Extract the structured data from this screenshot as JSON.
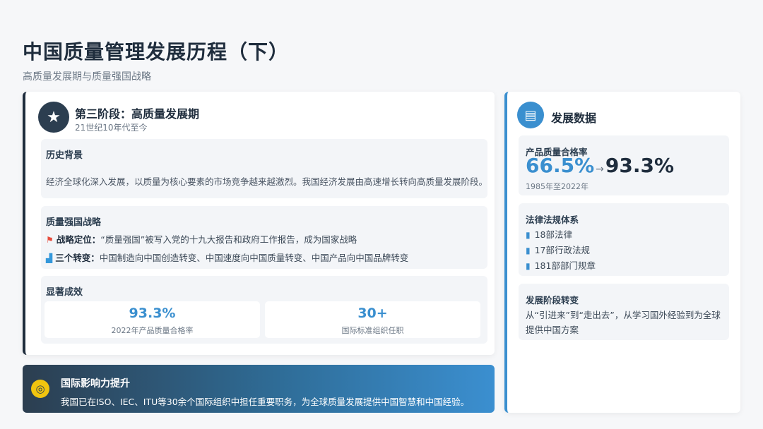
{
  "header": {
    "title": "中国质量管理发展历程（下）",
    "subtitle": "高质量发展期与质量强国战略"
  },
  "stage": {
    "icon": "star-icon",
    "title": "第三阶段：高质量发展期",
    "period": "21世纪10年代至今",
    "background": {
      "heading": "历史背景",
      "text": "经济全球化深入发展，以质量为核心要素的市场竞争越来越激烈。我国经济发展由高速增长转向高质量发展阶段。"
    },
    "strategy": {
      "heading": "质量强国战略",
      "items": [
        {
          "icon": "flag-icon",
          "label": "战略定位：",
          "text": "“质量强国”被写入党的十九大报告和政府工作报告，成为国家战略"
        },
        {
          "icon": "industry-icon",
          "label": "三个转变：",
          "text": "中国制造向中国创造转变、中国速度向中国质量转变、中国产品向中国品牌转变"
        }
      ]
    },
    "results": {
      "heading": "显著成效",
      "items": [
        {
          "value": "93.3%",
          "label": "2022年产品质量合格率"
        },
        {
          "value": "30+",
          "label": "国际标准组织任职"
        }
      ]
    }
  },
  "influence": {
    "icon": "globe-icon",
    "title": "国际影响力提升",
    "text": "我国已在ISO、IEC、ITU等30余个国际组织中担任重要职务，为全球质量发展提供中国智慧和中国经验。"
  },
  "data": {
    "icon": "chart-icon",
    "title": "发展数据",
    "rate": {
      "heading": "产品质量合格率",
      "from": "66.5%",
      "arrow": "→",
      "to": "93.3%",
      "note": "1985年至2022年"
    },
    "laws": {
      "heading": "法律法规体系",
      "items": [
        "18部法律",
        "17部行政法规",
        "181部部门规章"
      ]
    },
    "transition": {
      "heading": "发展阶段转变",
      "text": "从“引进来”到“走出去”，从学习国外经验到为全球提供中国方案"
    }
  },
  "colors": {
    "accent": "#3a8fcf",
    "dark": "#2c3e50",
    "flag": "#e74c3c",
    "globe": "#f1c40f"
  }
}
